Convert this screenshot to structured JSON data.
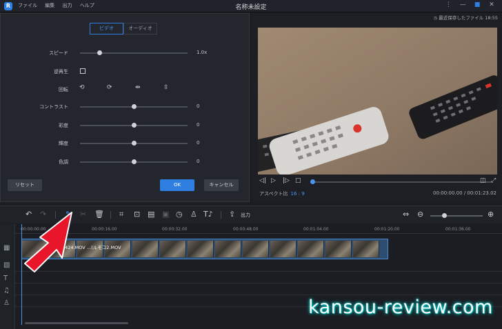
{
  "app": {
    "logo_letter": "R",
    "title": "名称未設定",
    "menu": [
      "ファイル",
      "編集",
      "出力",
      "ヘルプ"
    ],
    "window_controls": [
      "⋮",
      "—",
      "■",
      "✕"
    ]
  },
  "editor": {
    "tabs": [
      {
        "label": "ビデオ",
        "active": true
      },
      {
        "label": "オーディオ",
        "active": false
      }
    ],
    "speed": {
      "label": "スピード",
      "value_text": "1.0x",
      "level": 0.18
    },
    "reverse": {
      "label": "逆再生",
      "checked": false
    },
    "rotate": {
      "label": "回転",
      "icons": [
        "rotate-left-icon",
        "rotate-right-icon",
        "flip-horizontal-icon",
        "flip-vertical-icon"
      ]
    },
    "adjustments": [
      {
        "label": "コントラスト",
        "value": "0",
        "level": 0.5
      },
      {
        "label": "彩度",
        "value": "0",
        "level": 0.5
      },
      {
        "label": "輝度",
        "value": "0",
        "level": 0.5
      },
      {
        "label": "色調",
        "value": "0",
        "level": 0.5
      }
    ],
    "reset_label": "リセット",
    "ok_label": "OK",
    "cancel_label": "キャンセル"
  },
  "preview": {
    "recent_save": "最近保存したファイル 18:55",
    "aspect_label": "アスペクト比",
    "aspect_value": "16 : 9",
    "time_current": "00:00:00.00",
    "time_total": "00:01:23.02",
    "time_separator": "/",
    "progress": 0.0
  },
  "toolbar": {
    "export_label": "出力"
  },
  "timeline": {
    "ticks": [
      "00:00:00.00",
      "00:00:16.00",
      "00:00:32.00",
      "00:00:48.00",
      "00:01:04.00",
      "00:01:20.00",
      "00:01:36.00"
    ],
    "clip_label": "2424.MOV",
    "clip_label_prefix": "…",
    "clip_label_mid": "…(ルモコ2.MOV"
  },
  "watermark": "kansou-review.com",
  "colors": {
    "accent": "#2f7fe3",
    "panel": "#23262c",
    "arrow": "#e8152b"
  }
}
